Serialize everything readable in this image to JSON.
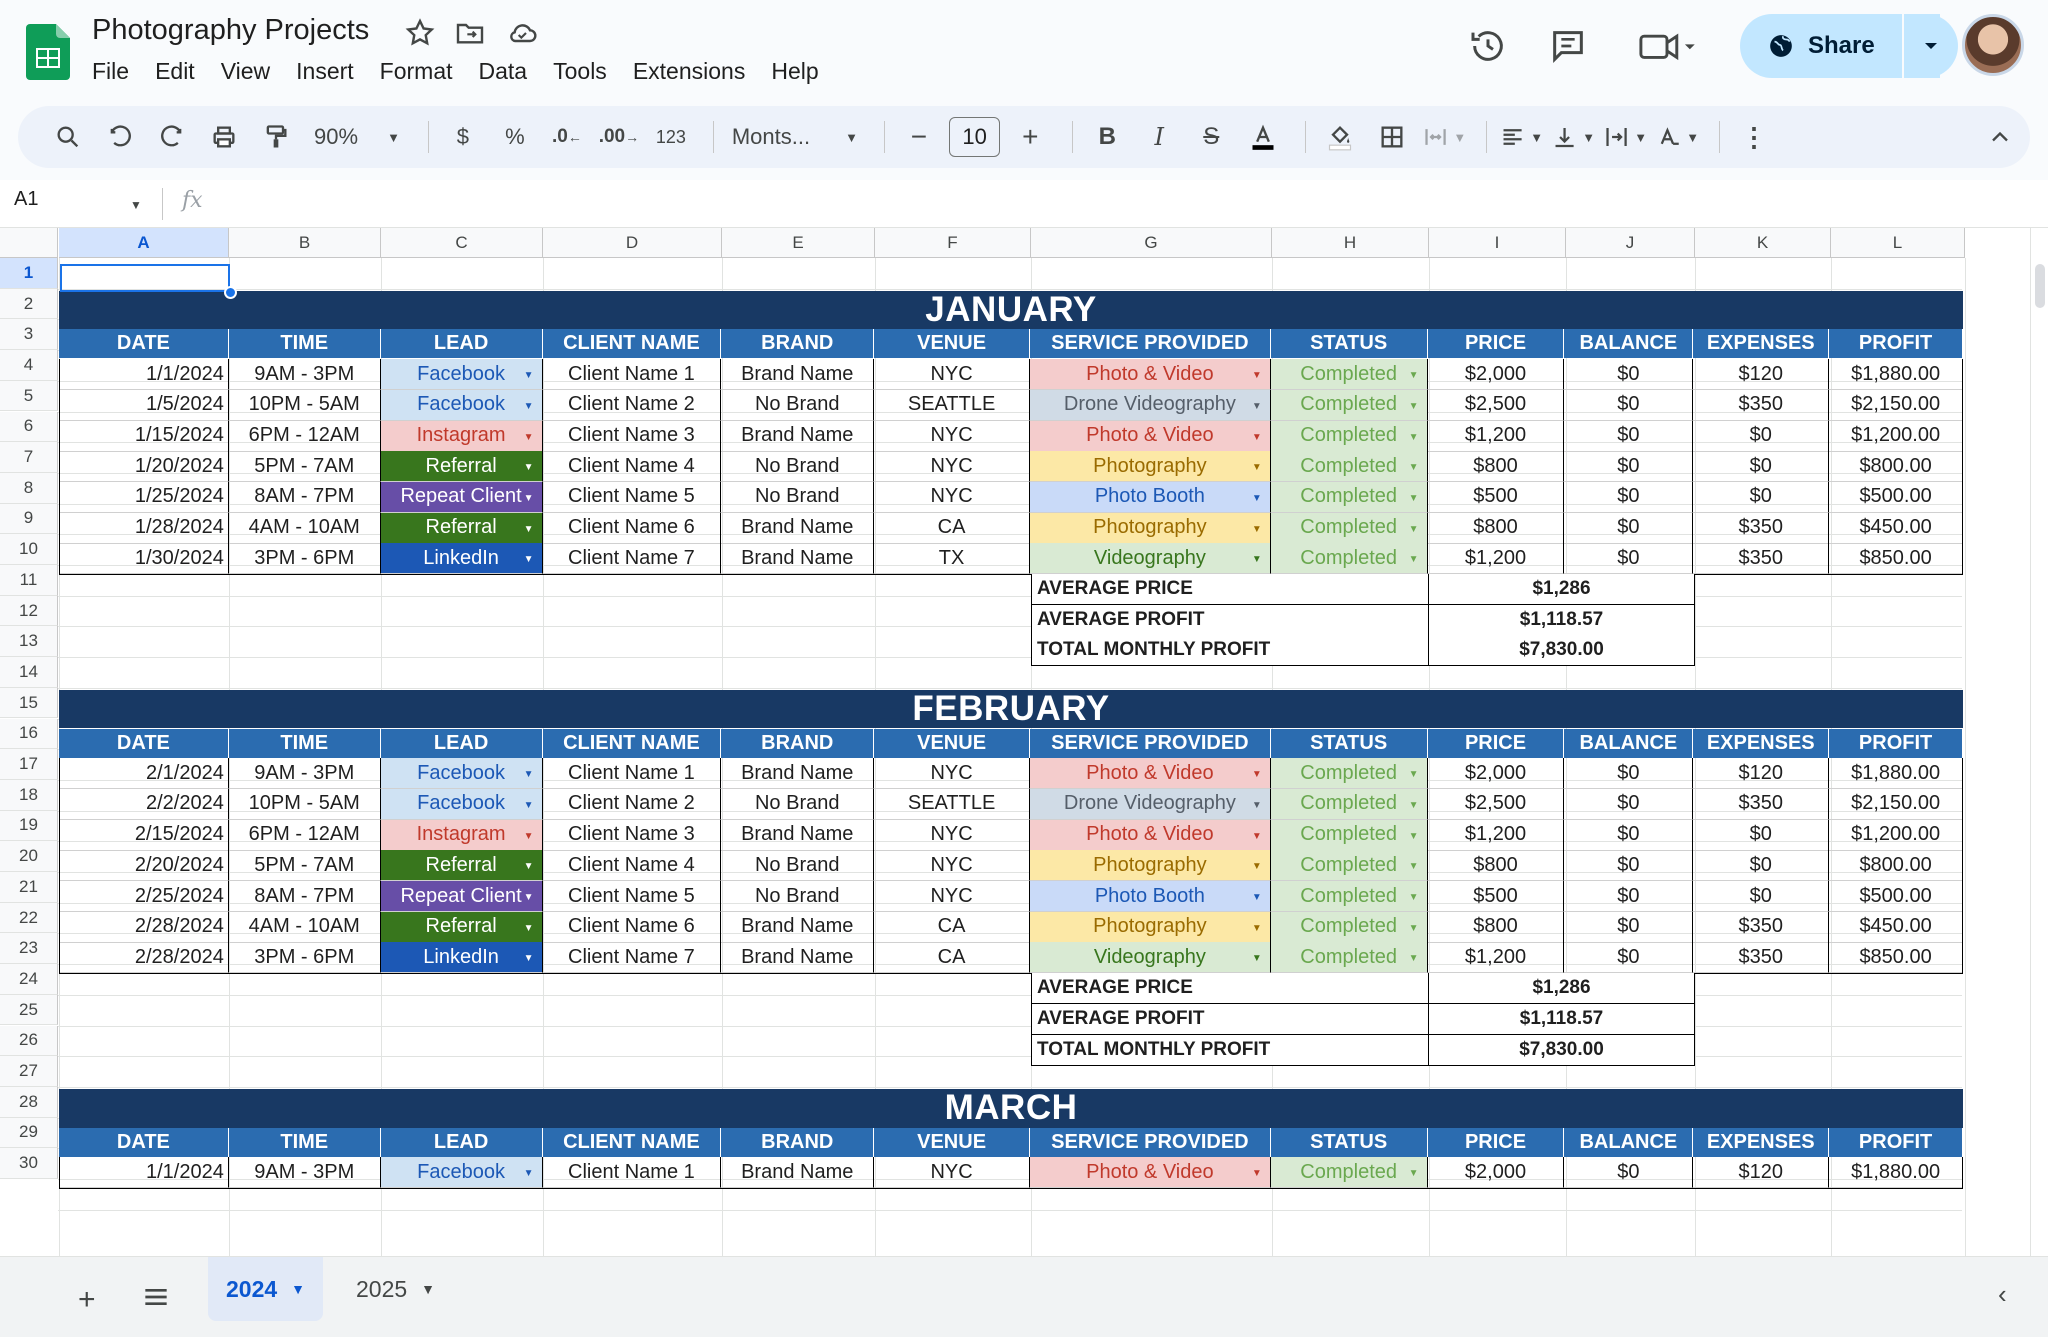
{
  "app": {
    "title": "Photography Projects",
    "menu": [
      "File",
      "Edit",
      "View",
      "Insert",
      "Format",
      "Data",
      "Tools",
      "Extensions",
      "Help"
    ],
    "share_label": "Share"
  },
  "toolbar": {
    "zoom": "90%",
    "currency": "$",
    "percent": "%",
    "dec_decrease": ".0",
    "dec_increase": ".00",
    "number_format": "123",
    "font": "Monts...",
    "font_size": "10"
  },
  "formula_bar": {
    "cell_ref": "A1",
    "fx": "fx",
    "value": ""
  },
  "columns": [
    "A",
    "B",
    "C",
    "D",
    "E",
    "F",
    "G",
    "H",
    "I",
    "J",
    "K",
    "L"
  ],
  "rows": [
    "1",
    "2",
    "3",
    "4",
    "5",
    "6",
    "7",
    "8",
    "9",
    "10",
    "11",
    "12",
    "13",
    "14",
    "15",
    "16",
    "17",
    "18",
    "19",
    "20",
    "21",
    "22",
    "23",
    "24",
    "25",
    "26",
    "27",
    "28",
    "29",
    "30"
  ],
  "table_headers": [
    "DATE",
    "TIME",
    "LEAD",
    "CLIENT NAME",
    "BRAND",
    "VENUE",
    "SERVICE PROVIDED",
    "STATUS",
    "PRICE",
    "BALANCE",
    "EXPENSES",
    "PROFIT"
  ],
  "colors": {
    "band": "#183964",
    "header": "#2b6cb0",
    "lead": {
      "Facebook": {
        "bg": "#cfe2f3",
        "fg": "#1c58b5"
      },
      "Instagram": {
        "bg": "#f4cccc",
        "fg": "#c0392b"
      },
      "Referral": {
        "bg": "#38761d",
        "fg": "#ffffff"
      },
      "Repeat Client": {
        "bg": "#674ea7",
        "fg": "#ffffff"
      },
      "LinkedIn": {
        "bg": "#1c58b5",
        "fg": "#ffffff"
      }
    },
    "service": {
      "Photo & Video": {
        "bg": "#f4cccc",
        "fg": "#c0392b"
      },
      "Drone Videography": {
        "bg": "#d0dbe6",
        "fg": "#555e69"
      },
      "Photography": {
        "bg": "#fce8a6",
        "fg": "#9a6b00"
      },
      "Photo Booth": {
        "bg": "#c9daf8",
        "fg": "#1c58b5"
      },
      "Videography": {
        "bg": "#d9ead3",
        "fg": "#38761d"
      }
    },
    "status": {
      "Completed": {
        "bg": "#d9ead3",
        "fg": "#6aa84f"
      }
    }
  },
  "months": [
    {
      "name": "JANUARY",
      "rows": [
        [
          "1/1/2024",
          "9AM - 3PM",
          "Facebook",
          "Client Name 1",
          "Brand Name",
          "NYC",
          "Photo & Video",
          "Completed",
          "$2,000",
          "$0",
          "$120",
          "$1,880.00"
        ],
        [
          "1/5/2024",
          "10PM - 5AM",
          "Facebook",
          "Client Name 2",
          "No Brand",
          "SEATTLE",
          "Drone Videography",
          "Completed",
          "$2,500",
          "$0",
          "$350",
          "$2,150.00"
        ],
        [
          "1/15/2024",
          "6PM - 12AM",
          "Instagram",
          "Client Name 3",
          "Brand Name",
          "NYC",
          "Photo & Video",
          "Completed",
          "$1,200",
          "$0",
          "$0",
          "$1,200.00"
        ],
        [
          "1/20/2024",
          "5PM - 7AM",
          "Referral",
          "Client Name 4",
          "No Brand",
          "NYC",
          "Photography",
          "Completed",
          "$800",
          "$0",
          "$0",
          "$800.00"
        ],
        [
          "1/25/2024",
          "8AM - 7PM",
          "Repeat Client",
          "Client Name 5",
          "No Brand",
          "NYC",
          "Photo Booth",
          "Completed",
          "$500",
          "$0",
          "$0",
          "$500.00"
        ],
        [
          "1/28/2024",
          "4AM - 10AM",
          "Referral",
          "Client Name 6",
          "Brand Name",
          "CA",
          "Photography",
          "Completed",
          "$800",
          "$0",
          "$350",
          "$450.00"
        ],
        [
          "1/30/2024",
          "3PM - 6PM",
          "LinkedIn",
          "Client Name 7",
          "Brand Name",
          "TX",
          "Videography",
          "Completed",
          "$1,200",
          "$0",
          "$350",
          "$850.00"
        ]
      ],
      "summary": [
        {
          "label": "AVERAGE PRICE",
          "value": "$1,286"
        },
        {
          "label": "AVERAGE PROFIT",
          "value": "$1,118.57"
        },
        {
          "label": "TOTAL MONTHLY PROFIT",
          "value": "$7,830.00"
        }
      ]
    },
    {
      "name": "FEBRUARY",
      "rows": [
        [
          "2/1/2024",
          "9AM - 3PM",
          "Facebook",
          "Client Name 1",
          "Brand Name",
          "NYC",
          "Photo & Video",
          "Completed",
          "$2,000",
          "$0",
          "$120",
          "$1,880.00"
        ],
        [
          "2/2/2024",
          "10PM - 5AM",
          "Facebook",
          "Client Name 2",
          "No Brand",
          "SEATTLE",
          "Drone Videography",
          "Completed",
          "$2,500",
          "$0",
          "$350",
          "$2,150.00"
        ],
        [
          "2/15/2024",
          "6PM - 12AM",
          "Instagram",
          "Client Name 3",
          "Brand Name",
          "NYC",
          "Photo & Video",
          "Completed",
          "$1,200",
          "$0",
          "$0",
          "$1,200.00"
        ],
        [
          "2/20/2024",
          "5PM - 7AM",
          "Referral",
          "Client Name 4",
          "No Brand",
          "NYC",
          "Photography",
          "Completed",
          "$800",
          "$0",
          "$0",
          "$800.00"
        ],
        [
          "2/25/2024",
          "8AM - 7PM",
          "Repeat Client",
          "Client Name 5",
          "No Brand",
          "NYC",
          "Photo Booth",
          "Completed",
          "$500",
          "$0",
          "$0",
          "$500.00"
        ],
        [
          "2/28/2024",
          "4AM - 10AM",
          "Referral",
          "Client Name 6",
          "Brand Name",
          "CA",
          "Photography",
          "Completed",
          "$800",
          "$0",
          "$350",
          "$450.00"
        ],
        [
          "2/28/2024",
          "3PM - 6PM",
          "LinkedIn",
          "Client Name 7",
          "Brand Name",
          "CA",
          "Videography",
          "Completed",
          "$1,200",
          "$0",
          "$350",
          "$850.00"
        ]
      ],
      "summary": [
        {
          "label": "AVERAGE PRICE",
          "value": "$1,286"
        },
        {
          "label": "AVERAGE PROFIT",
          "value": "$1,118.57"
        },
        {
          "label": "TOTAL MONTHLY PROFIT",
          "value": "$7,830.00"
        }
      ]
    },
    {
      "name": "MARCH",
      "rows": [
        [
          "1/1/2024",
          "9AM - 3PM",
          "Facebook",
          "Client Name 1",
          "Brand Name",
          "NYC",
          "Photo & Video",
          "Completed",
          "$2,000",
          "$0",
          "$120",
          "$1,880.00"
        ]
      ],
      "summary": []
    }
  ],
  "sheets": [
    {
      "name": "2024",
      "active": true
    },
    {
      "name": "2025",
      "active": false
    }
  ]
}
